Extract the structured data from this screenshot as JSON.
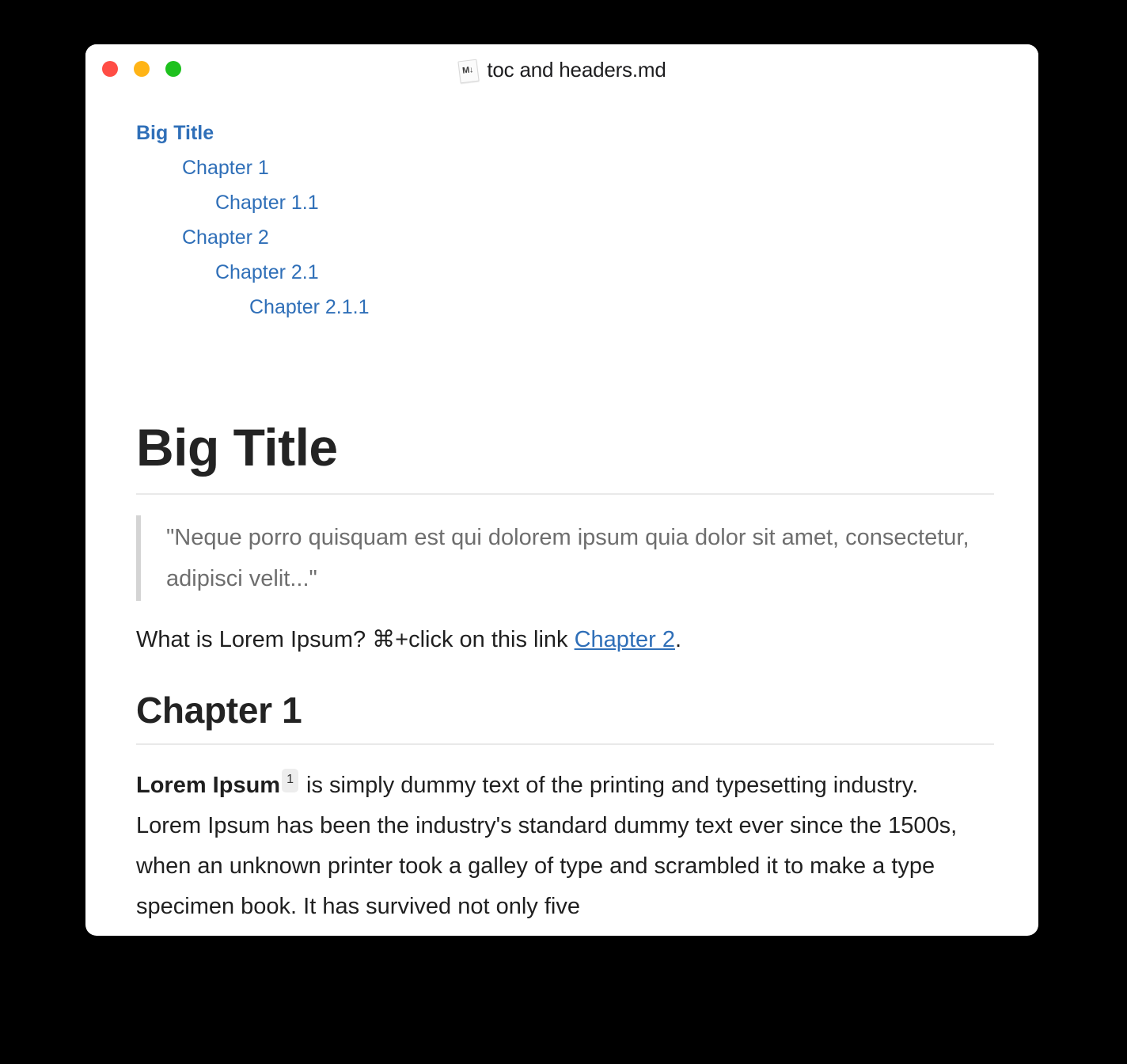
{
  "window": {
    "title": "toc and headers.md",
    "file_icon": "markdown-file-icon",
    "icon_glyph": "M↓",
    "traffic_lights": {
      "close_color": "#ff4d45",
      "minimize_color": "#ffb416",
      "zoom_color": "#1ec11e"
    }
  },
  "toc": {
    "items": [
      {
        "label": "Big Title",
        "level": 0
      },
      {
        "label": "Chapter 1",
        "level": 1
      },
      {
        "label": "Chapter 1.1",
        "level": 2
      },
      {
        "label": "Chapter 2",
        "level": 1
      },
      {
        "label": "Chapter 2.1",
        "level": 2
      },
      {
        "label": "Chapter 2.1.1",
        "level": 3
      }
    ]
  },
  "document": {
    "h1": "Big Title",
    "blockquote": "\"Neque porro quisquam est qui dolorem ipsum quia dolor sit amet, consectetur, adipisci velit...\"",
    "paragraph_link": {
      "before": "What is Lorem Ipsum? ⌘+click on this link ",
      "link_text": "Chapter 2",
      "after": "."
    },
    "h2": "Chapter 1",
    "body_paragraph": {
      "bold_lead": "Lorem Ipsum",
      "footnote_marker": "1",
      "rest": " is simply dummy text of the printing and typesetting industry. Lorem Ipsum has been the industry's standard dummy text ever since the 1500s, when an unknown printer took a galley of type and scrambled it to make a type specimen book. It has survived not only five"
    }
  },
  "colors": {
    "link": "#2f6fb8",
    "heading": "#232323",
    "body_text": "#1f1f1f",
    "quote_text": "#6e6e6e",
    "rule": "#e9e9e9",
    "quote_border": "#d4d4d4",
    "footnote_bg": "#ededed",
    "window_bg": "#ffffff",
    "desktop_bg": "#000000"
  }
}
